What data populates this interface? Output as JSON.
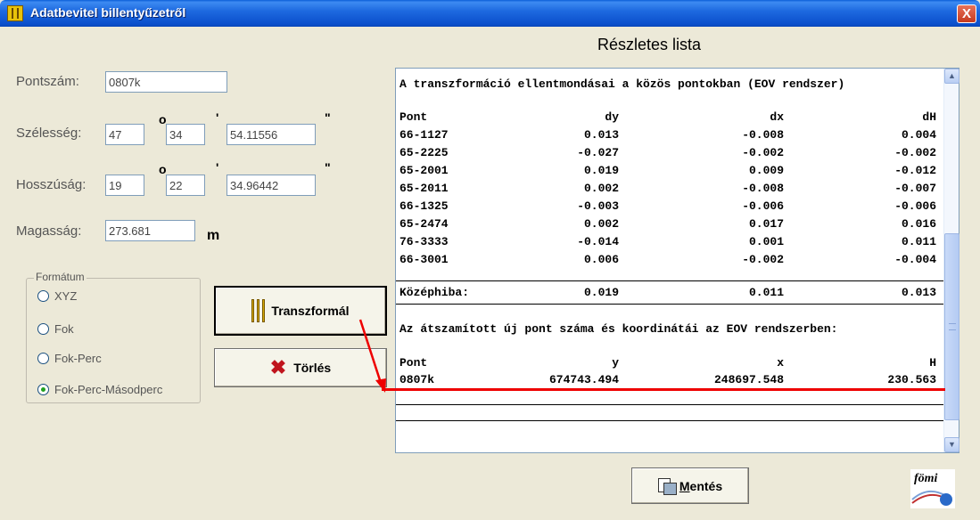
{
  "window": {
    "title": "Adatbevitel billentyűzetről",
    "close_label": "X"
  },
  "form": {
    "pontszam_label": "Pontszám:",
    "pontszam_value": "0807k",
    "szelesseg_label": "Szélesség:",
    "szelesseg_deg": "47",
    "szelesseg_min": "34",
    "szelesseg_sec": "54.11556",
    "hosszusag_label": "Hosszúság:",
    "hosszusag_deg": "19",
    "hosszusag_min": "22",
    "hosszusag_sec": "34.96442",
    "magassag_label": "Magasság:",
    "magassag_value": "273.681",
    "magassag_unit": "m",
    "deg_symbol": "o",
    "min_symbol": "'",
    "sec_symbol": "\""
  },
  "format_group": {
    "title": "Formátum",
    "options": [
      "XYZ",
      "Fok",
      "Fok-Perc",
      "Fok-Perc-Másodperc"
    ],
    "selected": "Fok-Perc-Másodperc"
  },
  "buttons": {
    "transzformal": "Transzformál",
    "torles": "Törlés",
    "mentes_u": "M",
    "mentes_rest": "entés"
  },
  "list": {
    "title": "Részletes lista",
    "heading1": "A transzformáció ellentmondásai a közös pontokban (EOV rendszer)",
    "columns": [
      "Pont",
      "dy",
      "dx",
      "dH"
    ],
    "rows": [
      [
        "66-1127",
        "0.013",
        "-0.008",
        "0.004"
      ],
      [
        "65-2225",
        "-0.027",
        "-0.002",
        "-0.002"
      ],
      [
        "65-2001",
        "0.019",
        "0.009",
        "-0.012"
      ],
      [
        "65-2011",
        "0.002",
        "-0.008",
        "-0.007"
      ],
      [
        "66-1325",
        "-0.003",
        "-0.006",
        "-0.006"
      ],
      [
        "65-2474",
        "0.002",
        "0.017",
        "0.016"
      ],
      [
        "76-3333",
        "-0.014",
        "0.001",
        "0.011"
      ],
      [
        "66-3001",
        "0.006",
        "-0.002",
        "-0.004"
      ]
    ],
    "kozephiba": [
      "Középhiba:",
      "0.019",
      "0.011",
      "0.013"
    ],
    "heading2": "Az átszamított új pont száma és koordinátái az EOV rendszerben:",
    "columns2": [
      "Pont",
      "y",
      "x",
      "H"
    ],
    "result": [
      "0807k",
      "674743.494",
      "248697.548",
      "230.563"
    ]
  },
  "logo_text": "fömi",
  "colors": {
    "annotation_red": "#E00000",
    "title_blue": "#0B4FCC"
  }
}
